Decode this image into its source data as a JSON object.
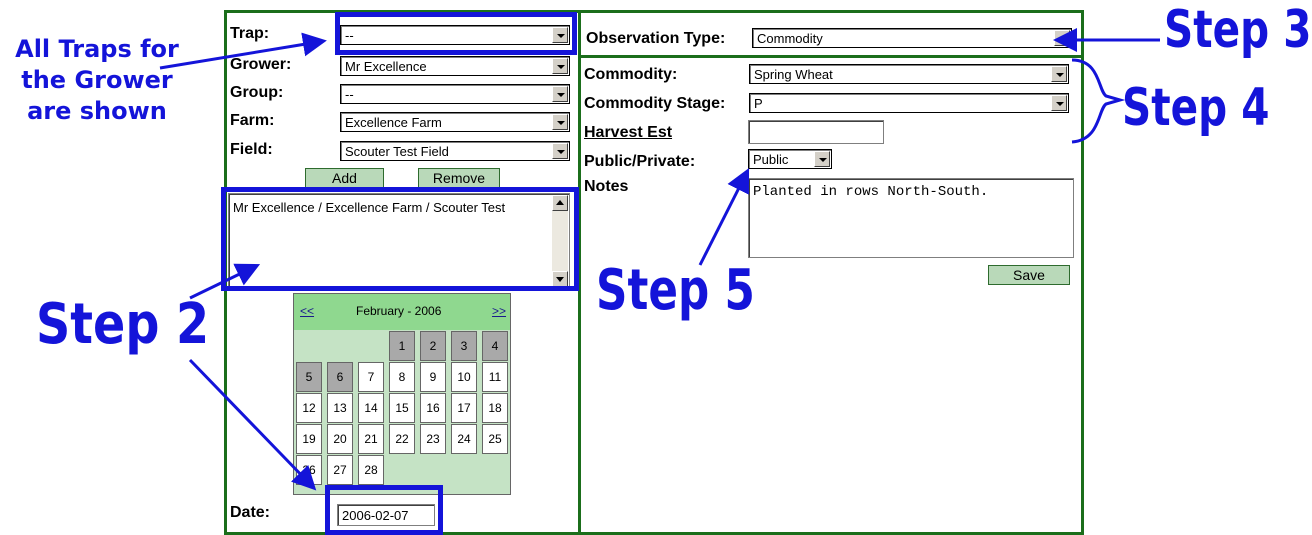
{
  "left_form": {
    "labels": {
      "trap": "Trap:",
      "grower": "Grower:",
      "group": "Group:",
      "farm": "Farm:",
      "field": "Field:",
      "date": "Date:"
    },
    "values": {
      "trap": "--",
      "grower": "Mr Excellence",
      "group": "--",
      "farm": "Excellence Farm",
      "field": "Scouter Test Field",
      "date": "2006-02-07"
    },
    "add_label": "Add",
    "remove_label": "Remove",
    "list_items": [
      "Mr Excellence / Excellence Farm / Scouter Test"
    ]
  },
  "calendar": {
    "prev": "<<",
    "next": ">>",
    "month_title": "February - 2006",
    "row1": [
      "1",
      "2",
      "3",
      "4"
    ],
    "row2": [
      "5",
      "6",
      "7",
      "8",
      "9",
      "10",
      "11"
    ],
    "row3": [
      "12",
      "13",
      "14",
      "15",
      "16",
      "17",
      "18"
    ],
    "row4": [
      "19",
      "20",
      "21",
      "22",
      "23",
      "24",
      "25"
    ],
    "row5": [
      "26",
      "27",
      "28"
    ]
  },
  "right_form": {
    "labels": {
      "observation_type": "Observation Type:",
      "commodity": "Commodity:",
      "commodity_stage": "Commodity Stage:",
      "harvest_est": "Harvest Est",
      "public_private": "Public/Private:",
      "notes": "Notes"
    },
    "values": {
      "observation_type": "Commodity",
      "commodity": "Spring Wheat",
      "commodity_stage": "P",
      "harvest_est": "",
      "public_private": "Public",
      "notes": "Planted in rows North-South."
    },
    "save_label": "Save"
  },
  "annotations": {
    "traps_note": [
      "All Traps for",
      "the Grower",
      "are shown"
    ],
    "step2": "Step 2",
    "step3": "Step 3",
    "step4": "Step 4",
    "step5": "Step 5",
    "color": "#1414d9"
  }
}
